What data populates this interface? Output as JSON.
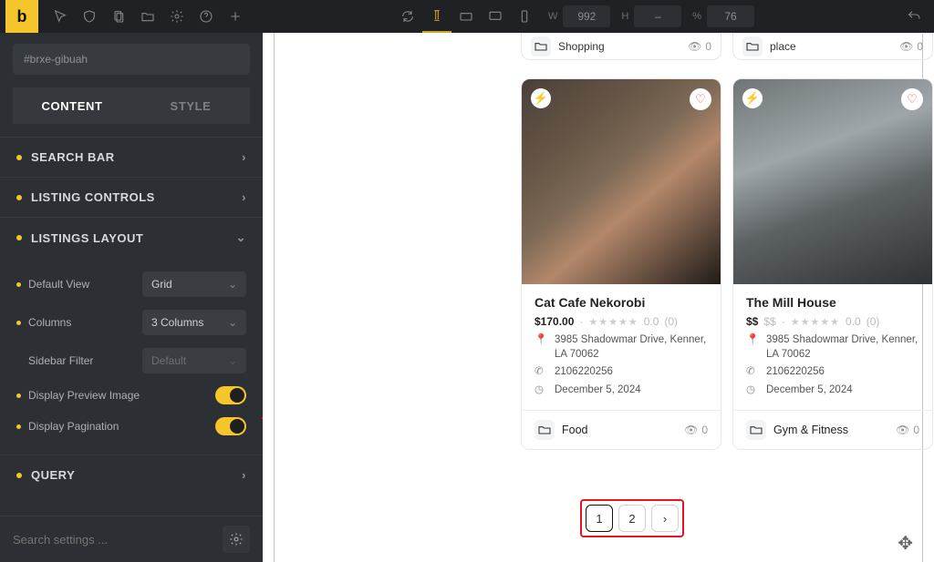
{
  "topbar": {
    "width_label": "W",
    "width_value": "992",
    "height_label": "H",
    "height_value": "–",
    "percent_label": "%",
    "percent_value": "76"
  },
  "sidebar": {
    "element_id": "#brxe-gibuah",
    "tabs": {
      "content": "CONTENT",
      "style": "STYLE"
    },
    "sections": {
      "search_bar": "SEARCH BAR",
      "listing_controls": "LISTING CONTROLS",
      "listings_layout": "LISTINGS LAYOUT",
      "query": "QUERY"
    },
    "layout": {
      "default_view_label": "Default View",
      "default_view_value": "Grid",
      "columns_label": "Columns",
      "columns_value": "3 Columns",
      "sidebar_filter_label": "Sidebar Filter",
      "sidebar_filter_value": "Default",
      "preview_image_label": "Display Preview Image",
      "pagination_label": "Display Pagination"
    },
    "search_placeholder": "Search settings ..."
  },
  "canvas": {
    "top_cards": [
      {
        "category": "Shopping",
        "views": "0"
      },
      {
        "category": "place",
        "views": "0"
      }
    ],
    "listings": [
      {
        "title": "Cat Cafe Nekorobi",
        "price": "$170.00",
        "rating": "0.0",
        "rating_count": "(0)",
        "address": "3985 Shadowmar Drive, Kenner, LA 70062",
        "phone": "2106220256",
        "date": "December 5, 2024",
        "category": "Food",
        "views": "0"
      },
      {
        "title": "The Mill House",
        "price": "$$",
        "price_grey": "$$",
        "rating": "0.0",
        "rating_count": "(0)",
        "address": "3985 Shadowmar Drive, Kenner, LA 70062",
        "phone": "2106220256",
        "date": "December 5, 2024",
        "category": "Gym & Fitness",
        "views": "0"
      }
    ],
    "pagination": {
      "page1": "1",
      "page2": "2"
    }
  }
}
